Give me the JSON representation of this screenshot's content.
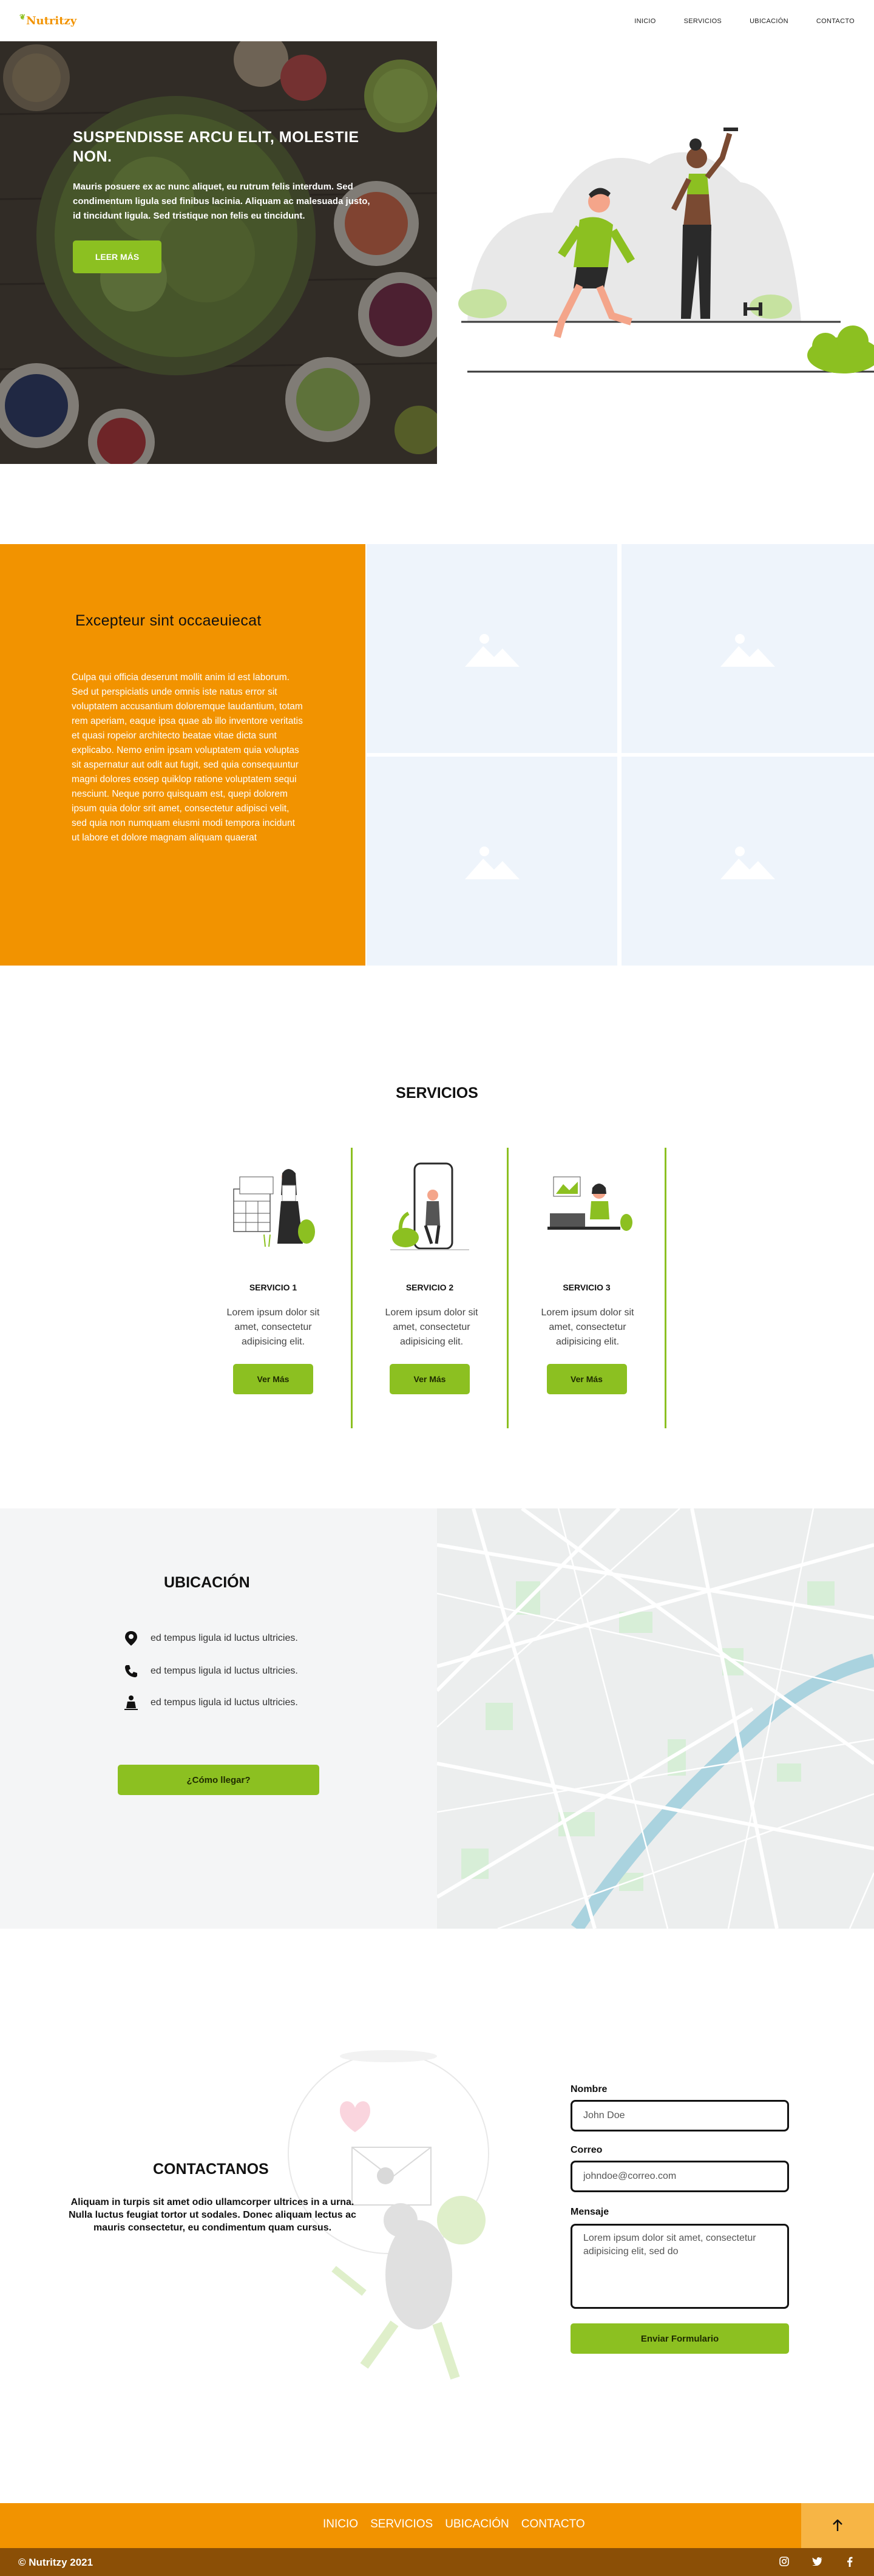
{
  "brand": {
    "name": "Nutritzy",
    "accent": "#f29300",
    "green": "#8cc021",
    "brown": "#8b4f06"
  },
  "nav": {
    "items": [
      "INICIO",
      "SERVICIOS",
      "UBICACIÓN",
      "CONTACTO"
    ]
  },
  "hero": {
    "title": "SUSPENDISSE ARCU ELIT, MOLESTIE NON.",
    "text": "Mauris posuere ex ac nunc aliquet, eu rutrum felis interdum. Sed condimentum ligula sed finibus lacinia. Aliquam ac malesuada justo, id tincidunt ligula. Sed tristique non felis eu tincidunt.",
    "button": "LEER MÁS"
  },
  "feature": {
    "title": "Excepteur sint occaeuiecat",
    "text": "Culpa qui officia deserunt mollit anim id est laborum. Sed ut perspiciatis unde omnis iste natus error sit voluptatem accusantium doloremque laudantium, totam rem aperiam, eaque ipsa quae ab illo inventore veritatis et quasi ropeior architecto beatae vitae dicta sunt explicabo. Nemo enim ipsam voluptatem quia voluptas sit aspernatur aut odit aut fugit, sed quia consequuntur magni dolores eosep quiklop ratione voluptatem sequi nesciunt. Neque porro quisquam est, quepi dolorem ipsum quia dolor srit amet, consectetur adipisci velit, sed quia non numquam eiusmi modi tempora incidunt ut labore et dolore magnam aliquam quaerat"
  },
  "services": {
    "title": "SERVICIOS",
    "items": [
      {
        "title": "SERVICIO 1",
        "text": "Lorem ipsum dolor sit amet, consectetur adipisicing elit.",
        "button": "Ver Más"
      },
      {
        "title": "SERVICIO 2",
        "text": "Lorem ipsum dolor sit amet, consectetur adipisicing elit.",
        "button": "Ver Más"
      },
      {
        "title": "SERVICIO 3",
        "text": "Lorem ipsum dolor sit amet, consectetur adipisicing elit.",
        "button": "Ver Más"
      }
    ]
  },
  "location": {
    "title": "UBICACIÓN",
    "items": [
      {
        "icon": "map-pin-icon",
        "text": "ed tempus ligula id luctus ultricies."
      },
      {
        "icon": "phone-icon",
        "text": "ed tempus ligula id luctus ultricies."
      },
      {
        "icon": "person-icon",
        "text": "ed tempus ligula id luctus ultricies."
      }
    ],
    "button": "¿Cómo llegar?"
  },
  "contact": {
    "title": "CONTACTANOS",
    "lead": "Aliquam in turpis sit amet odio ullamcorper ultrices in a urna. Nulla luctus feugiat tortor ut sodales. Donec aliquam lectus ac mauris consectetur, eu condimentum quam cursus.",
    "name_label": "Nombre",
    "name_value": "John Doe",
    "email_label": "Correo",
    "email_value": "johndoe@correo.com",
    "message_label": "Mensaje",
    "message_value": "Lorem ipsum dolor sit amet, consectetur adipisicing elit, sed do",
    "button": "Enviar Formulario"
  },
  "footer": {
    "items": [
      "INICIO",
      "SERVICIOS",
      "UBICACIÓN",
      "CONTACTO"
    ],
    "copyright": "© Nutritzy 2021",
    "social": [
      "instagram-icon",
      "twitter-icon",
      "facebook-icon"
    ]
  }
}
